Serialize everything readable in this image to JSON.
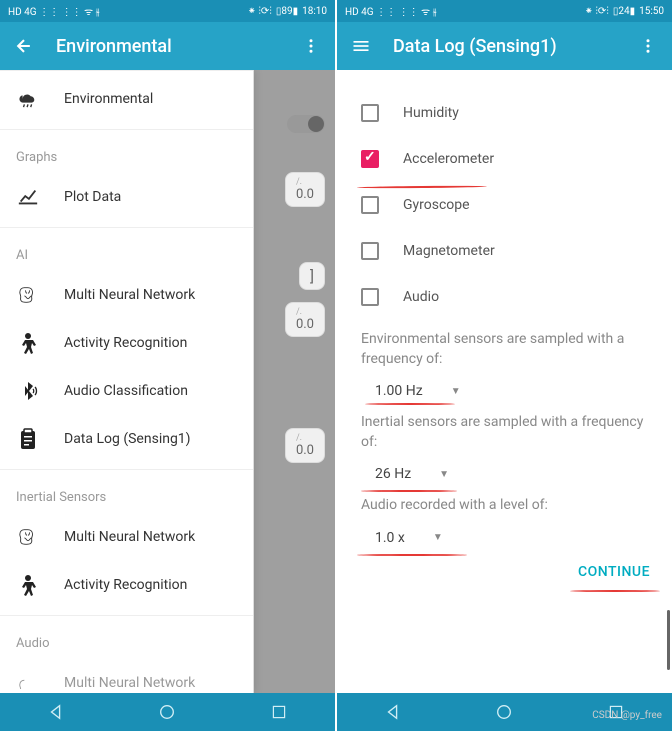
{
  "left": {
    "status": {
      "time": "18:10",
      "battery": "89",
      "indicators": "HD 4G ⋮⋮ ⋮⋮ ᯤ ⫳",
      "right_icons": "⁕ ⫶⟳⫶"
    },
    "appbar": {
      "title": "Environmental"
    },
    "drawer": {
      "item_env": "Environmental",
      "section_graphs": "Graphs",
      "item_plot": "Plot Data",
      "section_ai": "AI",
      "item_mnn": "Multi Neural Network",
      "item_activity": "Activity Recognition",
      "item_audio_class": "Audio Classification",
      "item_datalog": "Data Log (Sensing1)",
      "section_inertial": "Inertial Sensors",
      "item_mnn2": "Multi Neural Network",
      "item_activity2": "Activity Recognition",
      "section_audio": "Audio",
      "item_cut": "Multi Neural Network",
      "background_vals": [
        "0.0",
        "0.0",
        "0.0"
      ]
    }
  },
  "right": {
    "status": {
      "time": "15:50",
      "battery": "24",
      "indicators": "HD 4G ⋮⋮ ⋮⋮ ᯤ ⫳",
      "right_icons": "⁕ ⫶⟳⫶"
    },
    "appbar": {
      "title": "Data Log (Sensing1)"
    },
    "checks": {
      "humidity": "Humidity",
      "accelerometer": "Accelerometer",
      "gyroscope": "Gyroscope",
      "magnetometer": "Magnetometer",
      "audio": "Audio"
    },
    "labels": {
      "env_freq": "Environmental sensors are sampled with a frequency of:",
      "inertial_freq": "Inertial sensors are sampled with a frequency of:",
      "audio_level": "Audio recorded with a level of:"
    },
    "values": {
      "env_freq": "1.00 Hz",
      "inertial_freq": "26 Hz",
      "audio_level": "1.0 x"
    },
    "continue": "CONTINUE"
  },
  "watermark": "CSDN @py_free"
}
